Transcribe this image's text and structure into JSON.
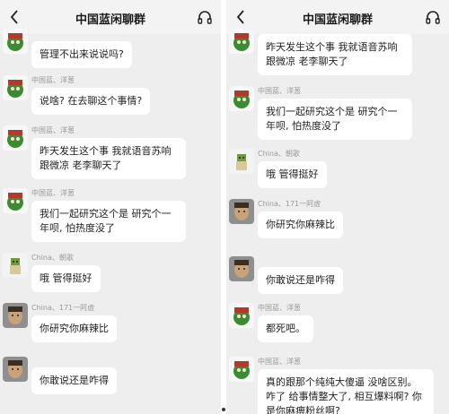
{
  "left_pane": {
    "title": "中国蓝闲聊群",
    "messages": [
      {
        "user": "",
        "text": "管理不出来说说吗?",
        "avatar": "green-character-avatar"
      },
      {
        "user": "中国蓝、洋葱",
        "text": "说啥? 在去聊这个事情?",
        "avatar": "green-character-avatar"
      },
      {
        "user": "中国蓝、洋葱",
        "text": "昨天发生这个事 我就语音苏响 跟微凉 老李聊天了",
        "avatar": "green-character-avatar"
      },
      {
        "user": "中国蓝、洋葱",
        "text": "我们一起研究这个是 研究个一年呗, 怕热度没了",
        "avatar": "green-character-avatar"
      },
      {
        "user": "China、朝歌",
        "text": "哦 管得挺好",
        "avatar": "small-figure-avatar"
      },
      {
        "user": "China、171一阿虚",
        "text": "你研究你麻辣比",
        "avatar": "face-avatar"
      },
      {
        "user": "",
        "text": "你敢说还是咋得",
        "avatar": "face-avatar"
      }
    ]
  },
  "right_pane": {
    "title": "中国蓝闲聊群",
    "messages": [
      {
        "user": "",
        "text": "昨天发生这个事 我就语音苏响 跟微凉 老李聊天了",
        "avatar": "green-character-avatar"
      },
      {
        "user": "中国蓝、洋葱",
        "text": "我们一起研究这个是 研究个一年呗, 怕热度没了",
        "avatar": "green-character-avatar"
      },
      {
        "user": "China、朝歌",
        "text": "哦 管得挺好",
        "avatar": "small-figure-avatar"
      },
      {
        "user": "China、171一阿虚",
        "text": "你研究你麻辣比",
        "avatar": "face-avatar"
      },
      {
        "user": "",
        "text": "你敢说还是咋得",
        "avatar": "face-avatar"
      },
      {
        "user": "中国蓝、洋葱",
        "text": "都死吧。",
        "avatar": "green-character-avatar"
      },
      {
        "user": "中国蓝、洋葱",
        "text": "真的跟那个纯纯大傻逼 没啥区别。咋了 给事情整大了, 相互爆料啊? 你是你麻痹粉丝啊?",
        "avatar": "green-character-avatar"
      }
    ]
  },
  "colors": {
    "bg": "#eeeeee",
    "bubble": "#ffffff",
    "text": "#222222",
    "username": "#9a9a9a"
  }
}
